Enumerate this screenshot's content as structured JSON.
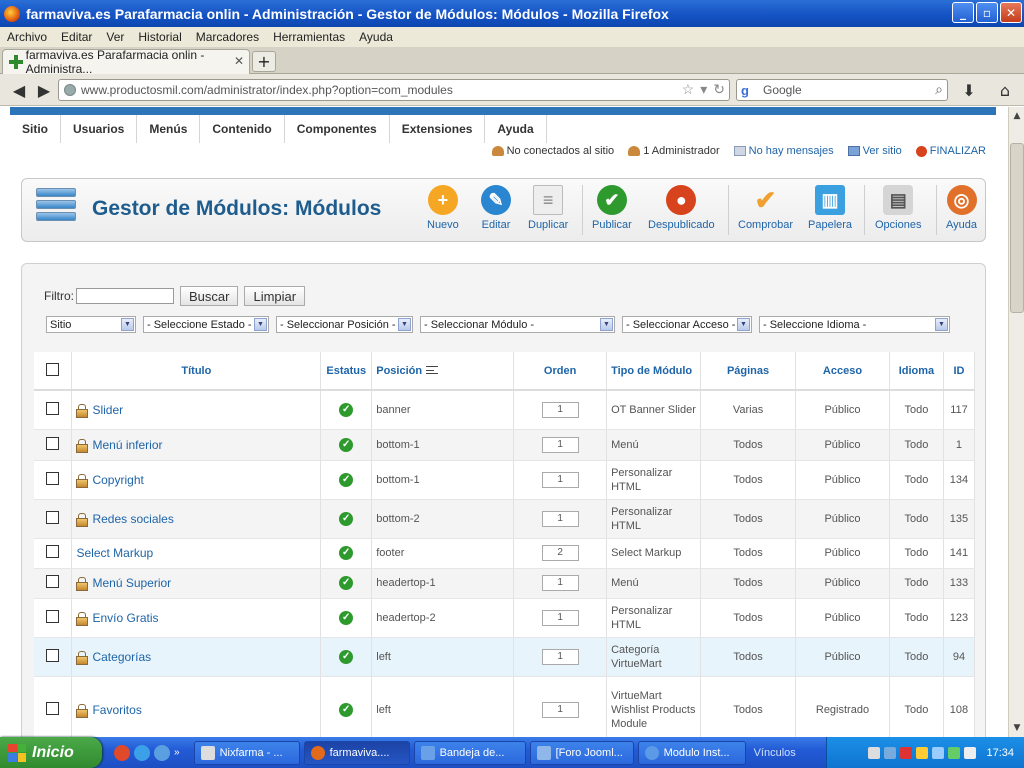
{
  "window": {
    "title": "farmaviva.es Parafarmacia onlin - Administración - Gestor de Módulos: Módulos - Mozilla Firefox",
    "controls": {
      "minimize": "_",
      "maximize": "▫",
      "close": "✕"
    }
  },
  "browser_menu": [
    "Archivo",
    "Editar",
    "Ver",
    "Historial",
    "Marcadores",
    "Herramientas",
    "Ayuda"
  ],
  "tab": {
    "label": "farmaviva.es Parafarmacia onlin - Administra...",
    "close": "✕",
    "new_tab": "+"
  },
  "nav": {
    "back": "◀",
    "forward": "▶",
    "url": "www.productosmil.com/administrator/index.php?option=com_modules",
    "search_placeholder": "Google",
    "download": "⬇",
    "home": "⌂"
  },
  "admin_menu": [
    "Sitio",
    "Usuarios",
    "Menús",
    "Contenido",
    "Componentes",
    "Extensiones",
    "Ayuda"
  ],
  "status_bar": {
    "not_connected": "No conectados al sitio",
    "admins": "1 Administrador",
    "messages": "No hay mensajes",
    "view_site": "Ver sitio",
    "logout": "FINALIZAR"
  },
  "toolbar": {
    "title": "Gestor de Módulos: Módulos",
    "buttons": [
      {
        "label": "Nuevo",
        "icon": "+",
        "color": "#f5a623"
      },
      {
        "label": "Editar",
        "icon": "✎",
        "color": "#2b86d1"
      },
      {
        "label": "Duplicar",
        "icon": "≡",
        "color": "#d9d9d9"
      },
      {
        "label": "Publicar",
        "icon": "✔",
        "color": "#2e9a2e"
      },
      {
        "label": "Despublicado",
        "icon": "●",
        "color": "#d6431d"
      },
      {
        "label": "Comprobar",
        "icon": "✔",
        "color": "#f0a030"
      },
      {
        "label": "Papelera",
        "icon": "▥",
        "color": "#3aa0e0"
      },
      {
        "label": "Opciones",
        "icon": "▤",
        "color": "#c9c9c9"
      },
      {
        "label": "Ayuda",
        "icon": "◎",
        "color": "#e0702a"
      }
    ]
  },
  "filters": {
    "label": "Filtro:",
    "search_value": "",
    "buscar": "Buscar",
    "limpiar": "Limpiar",
    "selects": [
      "Sitio",
      "- Seleccione Estado -",
      "- Seleccionar Posición -",
      "- Seleccionar Módulo -",
      "- Seleccionar Acceso -",
      "- Seleccione Idioma -"
    ]
  },
  "table": {
    "headers": {
      "titulo": "Título",
      "estatus": "Estatus",
      "posicion": "Posición",
      "orden": "Orden",
      "tipo": "Tipo de Módulo",
      "paginas": "Páginas",
      "acceso": "Acceso",
      "idioma": "Idioma",
      "id": "ID"
    },
    "rows": [
      {
        "title": "Slider",
        "locked": true,
        "position": "banner",
        "order": "1",
        "type": "OT Banner Slider",
        "pages": "Varias",
        "access": "Público",
        "lang": "Todo",
        "id": "117"
      },
      {
        "title": "Menú inferior",
        "locked": true,
        "position": "bottom-1",
        "order": "1",
        "type": "Menú",
        "pages": "Todos",
        "access": "Público",
        "lang": "Todo",
        "id": "1"
      },
      {
        "title": "Copyright",
        "locked": true,
        "position": "bottom-1",
        "order": "1",
        "type": "Personalizar HTML",
        "pages": "Todos",
        "access": "Público",
        "lang": "Todo",
        "id": "134"
      },
      {
        "title": "Redes sociales",
        "locked": true,
        "position": "bottom-2",
        "order": "1",
        "type": "Personalizar HTML",
        "pages": "Todos",
        "access": "Público",
        "lang": "Todo",
        "id": "135"
      },
      {
        "title": "Select Markup",
        "locked": false,
        "position": "footer",
        "order": "2",
        "type": "Select Markup",
        "pages": "Todos",
        "access": "Público",
        "lang": "Todo",
        "id": "141"
      },
      {
        "title": "Menú Superior",
        "locked": true,
        "position": "headertop-1",
        "order": "1",
        "type": "Menú",
        "pages": "Todos",
        "access": "Público",
        "lang": "Todo",
        "id": "133"
      },
      {
        "title": "Envío Gratis",
        "locked": true,
        "position": "headertop-2",
        "order": "1",
        "type": "Personalizar HTML",
        "pages": "Todos",
        "access": "Público",
        "lang": "Todo",
        "id": "123"
      },
      {
        "title": "Categorías",
        "locked": true,
        "position": "left",
        "order": "1",
        "type": "Categoría VirtueMart",
        "pages": "Todos",
        "access": "Público",
        "lang": "Todo",
        "id": "94"
      },
      {
        "title": "Favoritos",
        "locked": true,
        "position": "left",
        "order": "1",
        "type": "VirtueMart Wishlist Products Module",
        "pages": "Todos",
        "access": "Registrado",
        "lang": "Todo",
        "id": "108"
      }
    ]
  },
  "taskbar": {
    "start": "Inicio",
    "tasks": [
      "Nixfarma - ...",
      "farmaviva....",
      "Bandeja de...",
      "[Foro Jooml...",
      "Modulo Inst..."
    ],
    "links": "Vínculos",
    "clock": "17:34"
  }
}
